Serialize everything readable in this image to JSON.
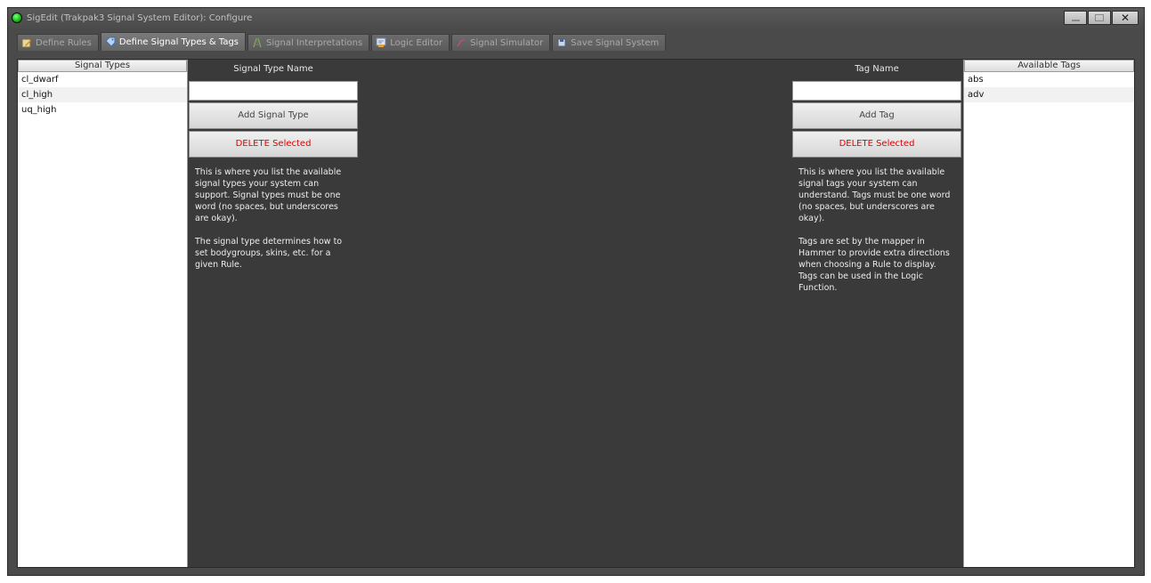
{
  "window": {
    "title": "SigEdit (Trakpak3 Signal System Editor): Configure",
    "app_icon": "green-signal-lamp-icon",
    "controls": {
      "minimize": "minimize-icon",
      "maximize": "maximize-icon",
      "close_glyph": "✕"
    }
  },
  "tabs": [
    {
      "label": "Define Rules",
      "icon": "pencil-note-icon",
      "active": false
    },
    {
      "label": "Define Signal Types & Tags",
      "icon": "tag-icon",
      "active": true
    },
    {
      "label": "Signal Interpretations",
      "icon": "track-icon",
      "active": false
    },
    {
      "label": "Logic Editor",
      "icon": "script-icon",
      "active": false
    },
    {
      "label": "Signal Simulator",
      "icon": "signal-arm-icon",
      "active": false
    },
    {
      "label": "Save Signal System",
      "icon": "save-icon",
      "active": false
    }
  ],
  "signal_types": {
    "header": "Signal Types",
    "items": [
      "cl_dwarf",
      "cl_high",
      "uq_high"
    ]
  },
  "signal_type_form": {
    "label": "Signal Type Name",
    "input_value": "",
    "add_button": "Add Signal Type",
    "delete_button": "DELETE Selected",
    "help": "This is where you list the available signal types your system can support. Signal types must be one word (no spaces, but underscores are okay).\n\nThe signal type determines how to set bodygroups, skins, etc. for a given Rule."
  },
  "tag_form": {
    "label": "Tag Name",
    "input_value": "",
    "add_button": "Add Tag",
    "delete_button": "DELETE Selected",
    "help": "This is where you list the available signal tags your system can understand. Tags must be one word (no spaces, but underscores are okay).\n\nTags are set by the mapper in Hammer to provide extra directions when choosing a Rule to display. Tags can be used in the Logic Function."
  },
  "available_tags": {
    "header": "Available Tags",
    "items": [
      "abs",
      "adv"
    ]
  },
  "colors": {
    "content_bg": "#3a3a3a",
    "delete_text": "#e00000",
    "active_tab_text": "#ffffff"
  }
}
